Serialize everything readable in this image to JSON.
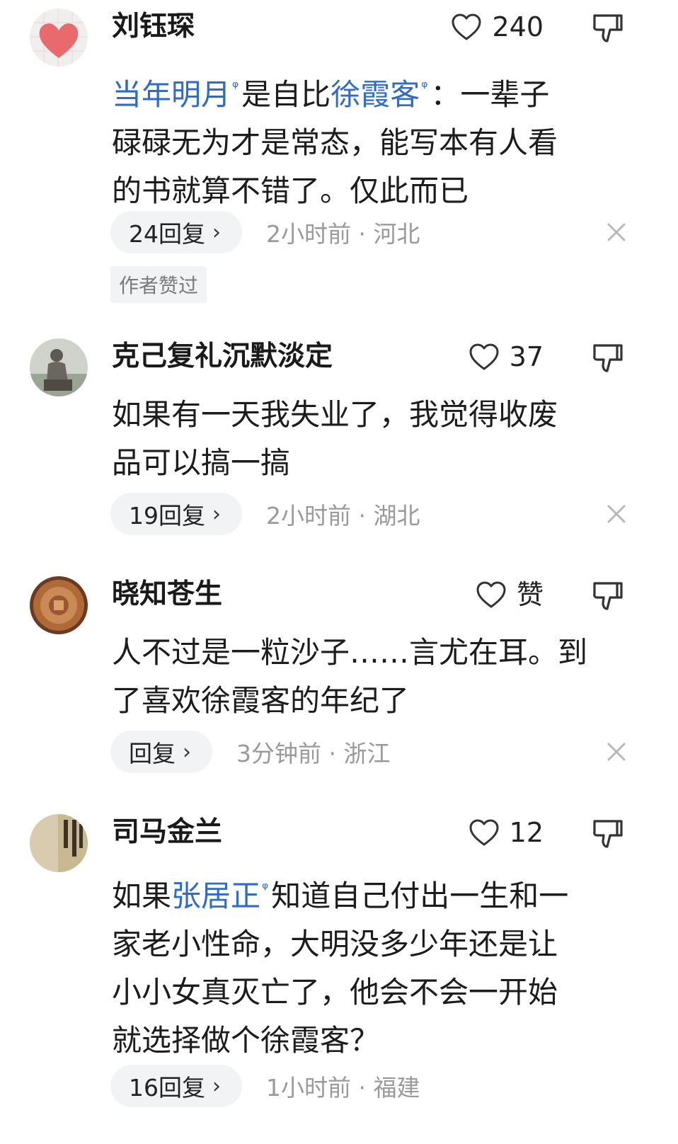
{
  "comments": [
    {
      "username": "刘钰琛",
      "likes": "240",
      "line1_link1": "当年明月",
      "line1_mid": "是自比",
      "line1_link2": "徐霞客",
      "line1_end": "：一辈子",
      "line2": "碌碌无为才是常态，能写本有人看",
      "line3": "的书就算不错了。仅此而已",
      "reply": "24回复",
      "meta": "2小时前 · 河北",
      "badge": "作者赞过"
    },
    {
      "username": "克己复礼沉默淡定",
      "likes": "37",
      "line1": "如果有一天我失业了，我觉得收废",
      "line2": "品可以搞一搞",
      "reply": "19回复",
      "meta": "2小时前 · 湖北"
    },
    {
      "username": "晓知苍生",
      "likes": "赞",
      "line1": "人不过是一粒沙子……言尤在耳。到",
      "line2": "了喜欢徐霞客的年纪了",
      "reply": "回复",
      "meta": "3分钟前 · 浙江"
    },
    {
      "username": "司马金兰",
      "likes": "12",
      "line1_start": "如果",
      "line1_link": "张居正",
      "line1_end": "知道自己付出一生和一",
      "line2": "家老小性命，大明没多少年还是让",
      "line3": "小小女真灭亡了，他会不会一开始",
      "line4": "就选择做个徐霞客？",
      "reply": "16回复",
      "meta": "1小时前 · 福建"
    }
  ],
  "icons": {
    "search_superscript": "ᵠ",
    "chevron": "›"
  },
  "colors": {
    "link": "#2f6bc7",
    "meta": "#9a9a9a",
    "pill_bg": "#f2f3f5"
  }
}
